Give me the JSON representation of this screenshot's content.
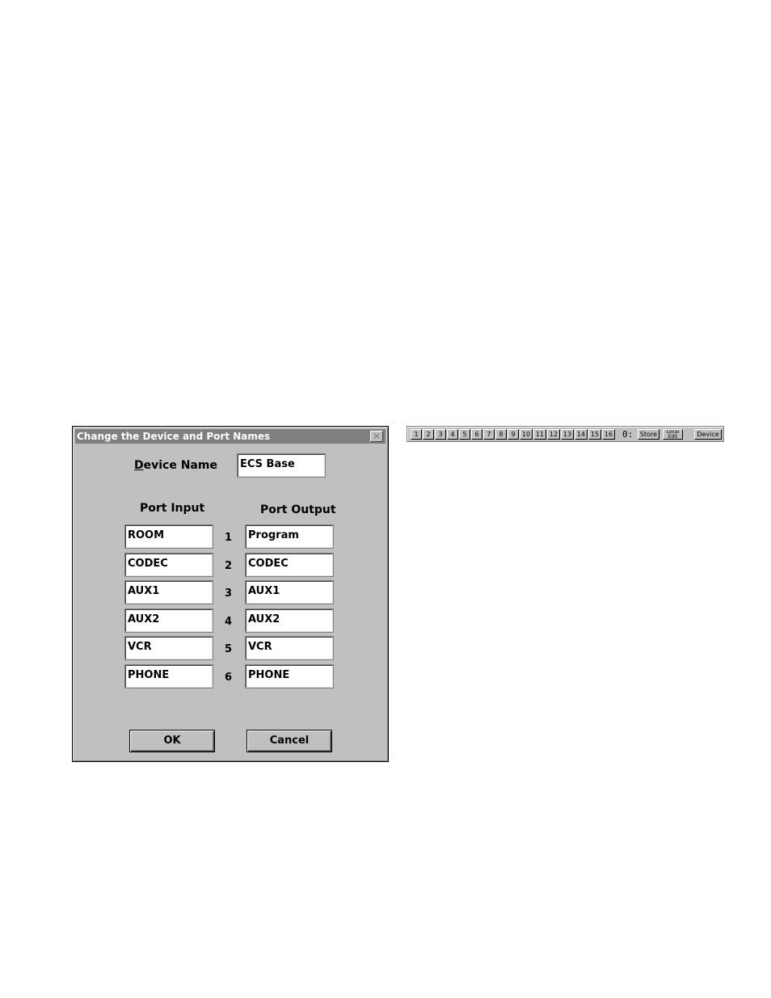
{
  "dialog": {
    "title": "Change the Device and Port Names",
    "close_symbol": "✕",
    "device_name_label_accel": "D",
    "device_name_label_rest": "evice Name",
    "device_name_value": "ECS Base",
    "port_input_label": "Port Input",
    "port_output_label": "Port Output",
    "ports": [
      {
        "number": "1",
        "input": "ROOM",
        "output": "Program"
      },
      {
        "number": "2",
        "input": "CODEC",
        "output": "CODEC"
      },
      {
        "number": "3",
        "input": "AUX1",
        "output": "AUX1"
      },
      {
        "number": "4",
        "input": "AUX2",
        "output": "AUX2"
      },
      {
        "number": "5",
        "input": "VCR",
        "output": "VCR"
      },
      {
        "number": "6",
        "input": "PHONE",
        "output": "PHONE"
      }
    ],
    "ok_label": "OK",
    "cancel_label": "Cancel"
  },
  "toolbar": {
    "preset_buttons": [
      "1",
      "2",
      "3",
      "4",
      "5",
      "6",
      "7",
      "8",
      "9",
      "10",
      "11",
      "12",
      "13",
      "14",
      "15",
      "16"
    ],
    "segment_display": "0:",
    "store_label": "Store",
    "local_edit_line1": "Local",
    "local_edit_line2": "Edit",
    "device_label": "Device"
  }
}
